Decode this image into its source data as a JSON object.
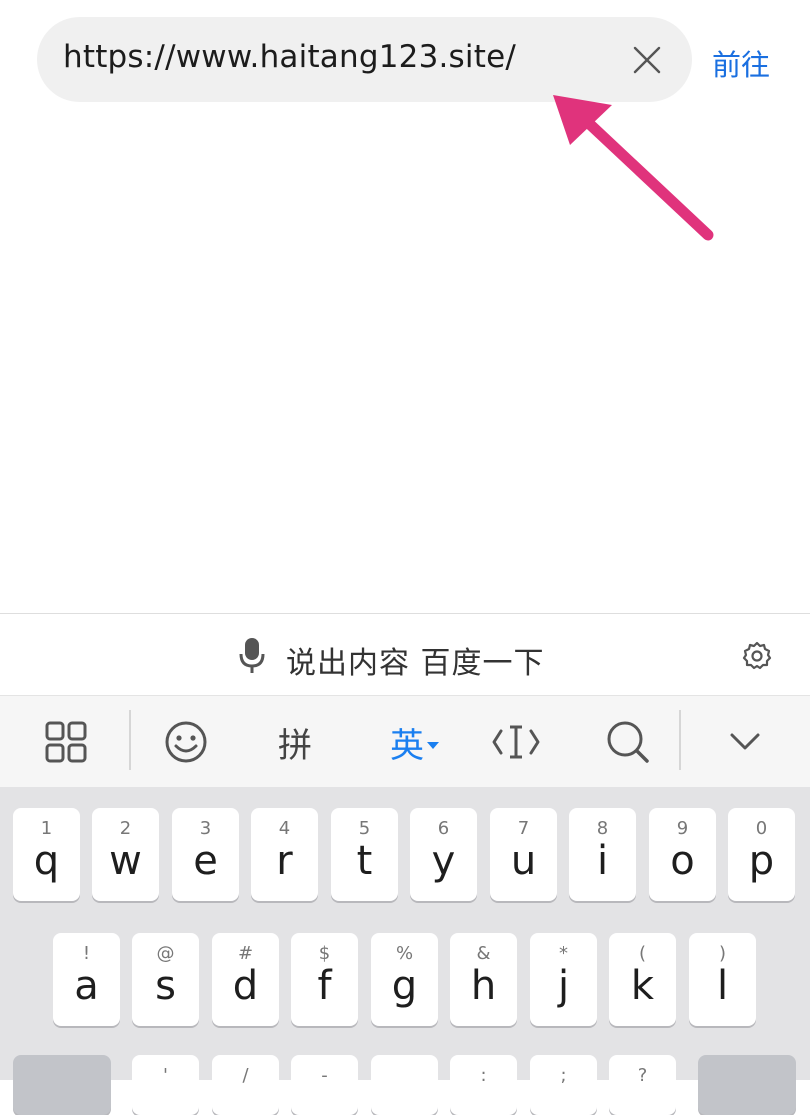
{
  "url_bar": {
    "url": "https://www.haitang123.site/",
    "clear_icon": "close-icon",
    "go_label": "前往"
  },
  "annotation": {
    "arrow_color": "#e0337c"
  },
  "voice_bar": {
    "mic_icon": "microphone-icon",
    "text": "说出内容 百度一下",
    "settings_icon": "gear-icon"
  },
  "toolbar": {
    "grid_icon": "grid-icon",
    "emoji_icon": "emoji-icon",
    "pinyin_label": "拼",
    "english_label": "英",
    "cursor_icon": "cursor-icon",
    "search_icon": "search-icon",
    "collapse_icon": "chevron-down-icon"
  },
  "keyboard": {
    "row1": [
      {
        "hint": "1",
        "key": "q"
      },
      {
        "hint": "2",
        "key": "w"
      },
      {
        "hint": "3",
        "key": "e"
      },
      {
        "hint": "4",
        "key": "r"
      },
      {
        "hint": "5",
        "key": "t"
      },
      {
        "hint": "6",
        "key": "y"
      },
      {
        "hint": "7",
        "key": "u"
      },
      {
        "hint": "8",
        "key": "i"
      },
      {
        "hint": "9",
        "key": "o"
      },
      {
        "hint": "0",
        "key": "p"
      }
    ],
    "row2": [
      {
        "hint": "!",
        "key": "a"
      },
      {
        "hint": "@",
        "key": "s"
      },
      {
        "hint": "#",
        "key": "d"
      },
      {
        "hint": "$",
        "key": "f"
      },
      {
        "hint": "%",
        "key": "g"
      },
      {
        "hint": "&",
        "key": "h"
      },
      {
        "hint": "*",
        "key": "j"
      },
      {
        "hint": "(",
        "key": "k"
      },
      {
        "hint": ")",
        "key": "l"
      }
    ],
    "row3_hints": [
      "'",
      "/",
      "-",
      ":",
      ";",
      "?"
    ]
  }
}
